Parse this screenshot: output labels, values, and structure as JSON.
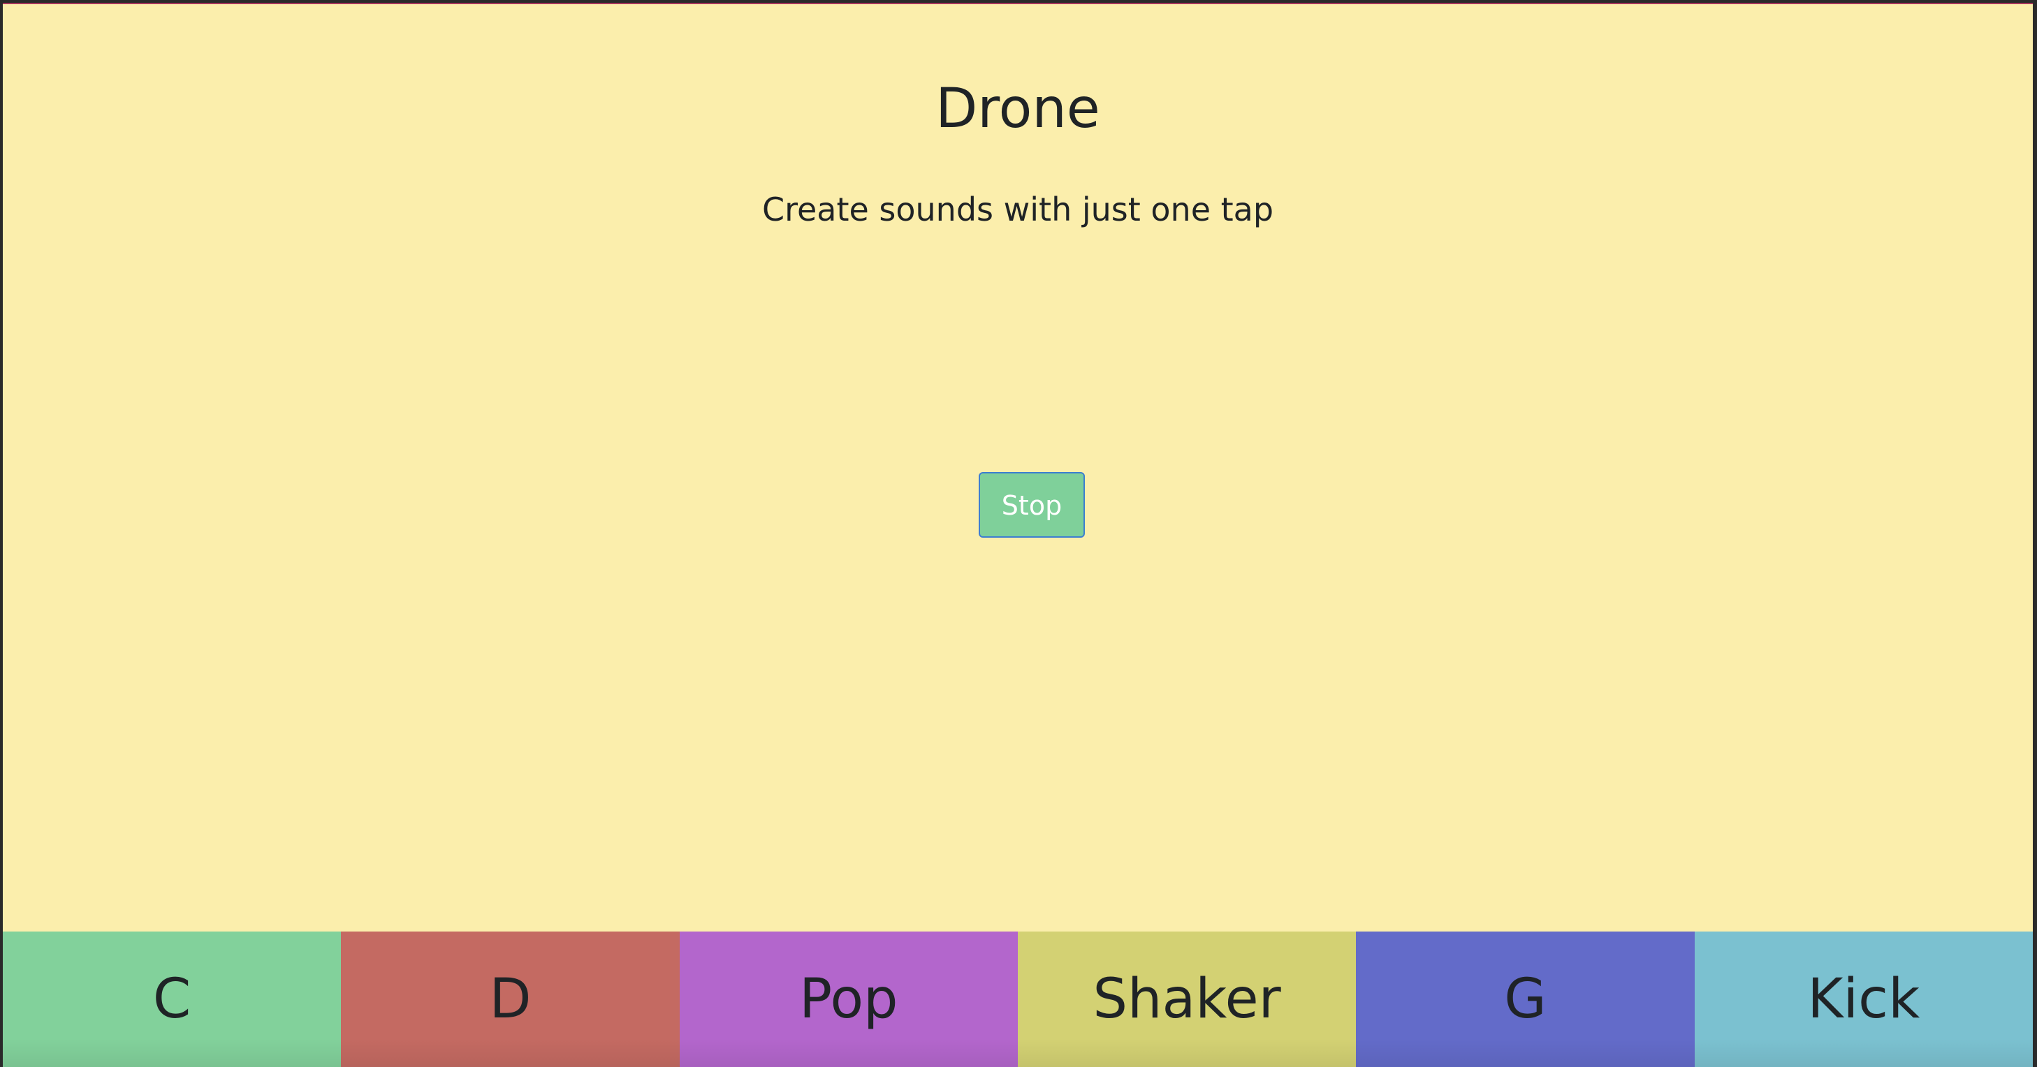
{
  "header": {
    "title": "Drone",
    "subtitle": "Create sounds with just one tap"
  },
  "controls": {
    "stop_label": "Stop"
  },
  "pads": [
    {
      "label": "C",
      "color": "#82d19b"
    },
    {
      "label": "D",
      "color": "#c46a62"
    },
    {
      "label": "Pop",
      "color": "#b366cc"
    },
    {
      "label": "Shaker",
      "color": "#d3d173"
    },
    {
      "label": "G",
      "color": "#636bc9"
    },
    {
      "label": "Kick",
      "color": "#7bc1d0"
    }
  ],
  "colors": {
    "background": "#fbeeac",
    "stop_button": "#7fd09a",
    "stop_button_border": "#3d7ed0",
    "text": "#1f2326"
  }
}
